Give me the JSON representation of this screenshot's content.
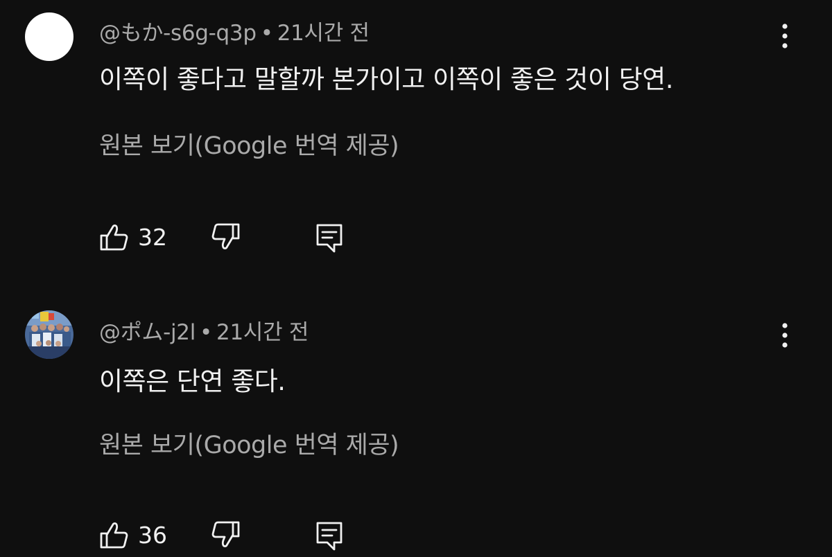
{
  "comments": [
    {
      "author": "@もか-s6g-q3p",
      "time": "21시간 전",
      "text": "이쪽이 좋다고 말할까 본가이고 이쪽이 좋은 것이 당연.",
      "translate_label": "원본 보기(Google 번역 제공)",
      "likes": "32",
      "avatar": "white-circle-avatar"
    },
    {
      "author": "@ポム-j2l",
      "time": "21시간 전",
      "text": "이쪽은 단연 좋다.",
      "translate_label": "원본 보기(Google 번역 제공)",
      "likes": "36",
      "avatar": "group-photo-avatar"
    }
  ],
  "separator": "•",
  "icons": {
    "like": "thumbs-up-icon",
    "dislike": "thumbs-down-icon",
    "reply": "reply-comment-icon",
    "more": "more-vertical-icon"
  },
  "colors": {
    "background": "#0f0f0f",
    "text": "#f1f1f1",
    "secondary": "#aaaaaa"
  }
}
